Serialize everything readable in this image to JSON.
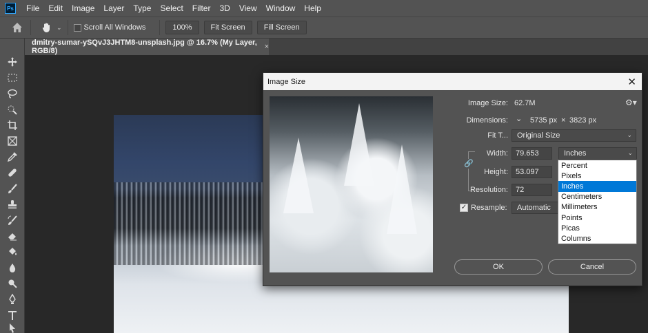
{
  "menu": [
    "File",
    "Edit",
    "Image",
    "Layer",
    "Type",
    "Select",
    "Filter",
    "3D",
    "View",
    "Window",
    "Help"
  ],
  "app_logo": "Ps",
  "options": {
    "scroll_all_windows": "Scroll All Windows",
    "zoom_100": "100%",
    "fit_screen": "Fit Screen",
    "fill_screen": "Fill Screen"
  },
  "document": {
    "tab_title": "dmitry-sumar-ySQvJ3JHTM8-unsplash.jpg @ 16.7% (My Layer, RGB/8)",
    "tab_close": "×"
  },
  "dialog": {
    "title": "Image Size",
    "close": "✕",
    "image_size_label": "Image Size:",
    "image_size_value": "62.7M",
    "dimensions_label": "Dimensions:",
    "dimensions_width": "5735 px",
    "dimensions_x": "×",
    "dimensions_height": "3823 px",
    "fit_to_label": "Fit T...",
    "fit_to_value": "Original Size",
    "width_label": "Width:",
    "width_value": "79.653",
    "width_unit": "Inches",
    "height_label": "Height:",
    "height_value": "53.097",
    "resolution_label": "Resolution:",
    "resolution_value": "72",
    "resample_label": "Resample:",
    "resample_value": "Automatic",
    "resample_checked": true,
    "ok_label": "OK",
    "cancel_label": "Cancel"
  },
  "unit_dropdown": {
    "options": [
      "Percent",
      "Pixels",
      "Inches",
      "Centimeters",
      "Millimeters",
      "Points",
      "Picas",
      "Columns"
    ],
    "selected": "Inches"
  },
  "icons": {
    "home": "home-icon",
    "hand": "hand-icon",
    "settings": "gear-icon",
    "link": "link-icon"
  },
  "colors": {
    "ui_panel": "#535353",
    "canvas_bg": "#282828",
    "selection": "#0078d7",
    "ps_brand": "#31a8ff"
  }
}
